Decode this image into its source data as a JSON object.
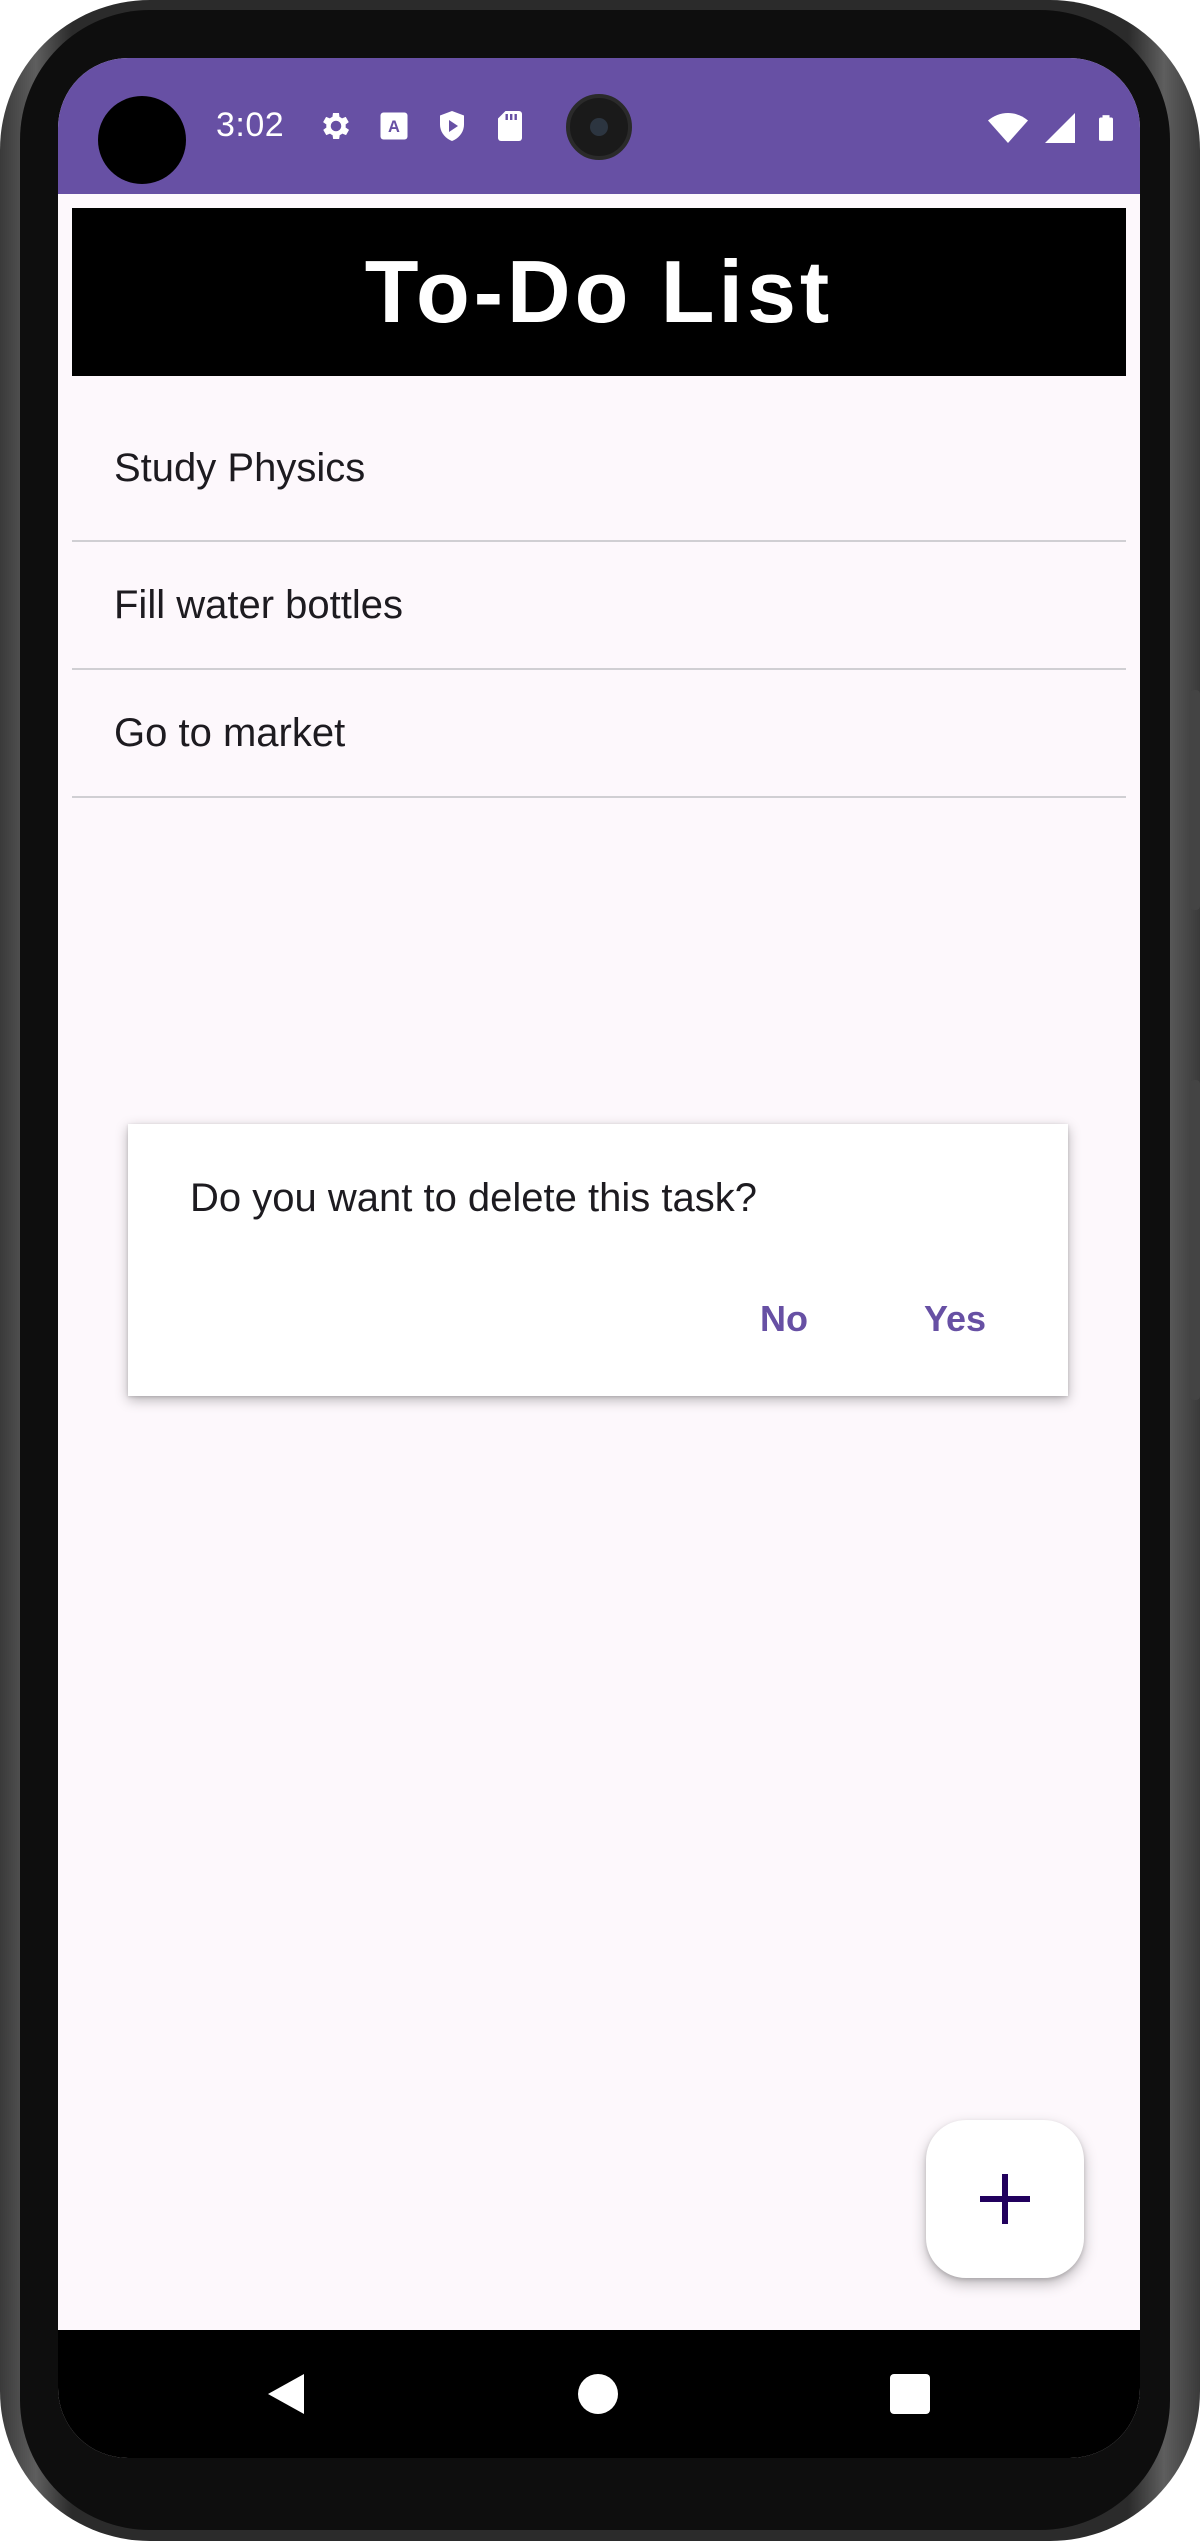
{
  "status_bar": {
    "time": "3:02",
    "left_icons": [
      "settings-icon",
      "keyboard-a-icon",
      "shield-icon",
      "sd-card-icon"
    ],
    "right_icons": [
      "wifi-icon",
      "signal-icon",
      "battery-icon"
    ],
    "background_color": "#6750a4"
  },
  "app": {
    "title": "To-Do List"
  },
  "tasks": [
    {
      "label": "Study Physics"
    },
    {
      "label": "Fill water bottles"
    },
    {
      "label": "Go to market"
    }
  ],
  "dialog": {
    "message": "Do you want to delete this task?",
    "no_label": "No",
    "yes_label": "Yes",
    "accent_color": "#6750a4"
  },
  "fab": {
    "icon": "plus-icon",
    "icon_color": "#21005d"
  },
  "nav_bar": {
    "icons": [
      "back-icon",
      "home-icon",
      "recents-icon"
    ]
  }
}
